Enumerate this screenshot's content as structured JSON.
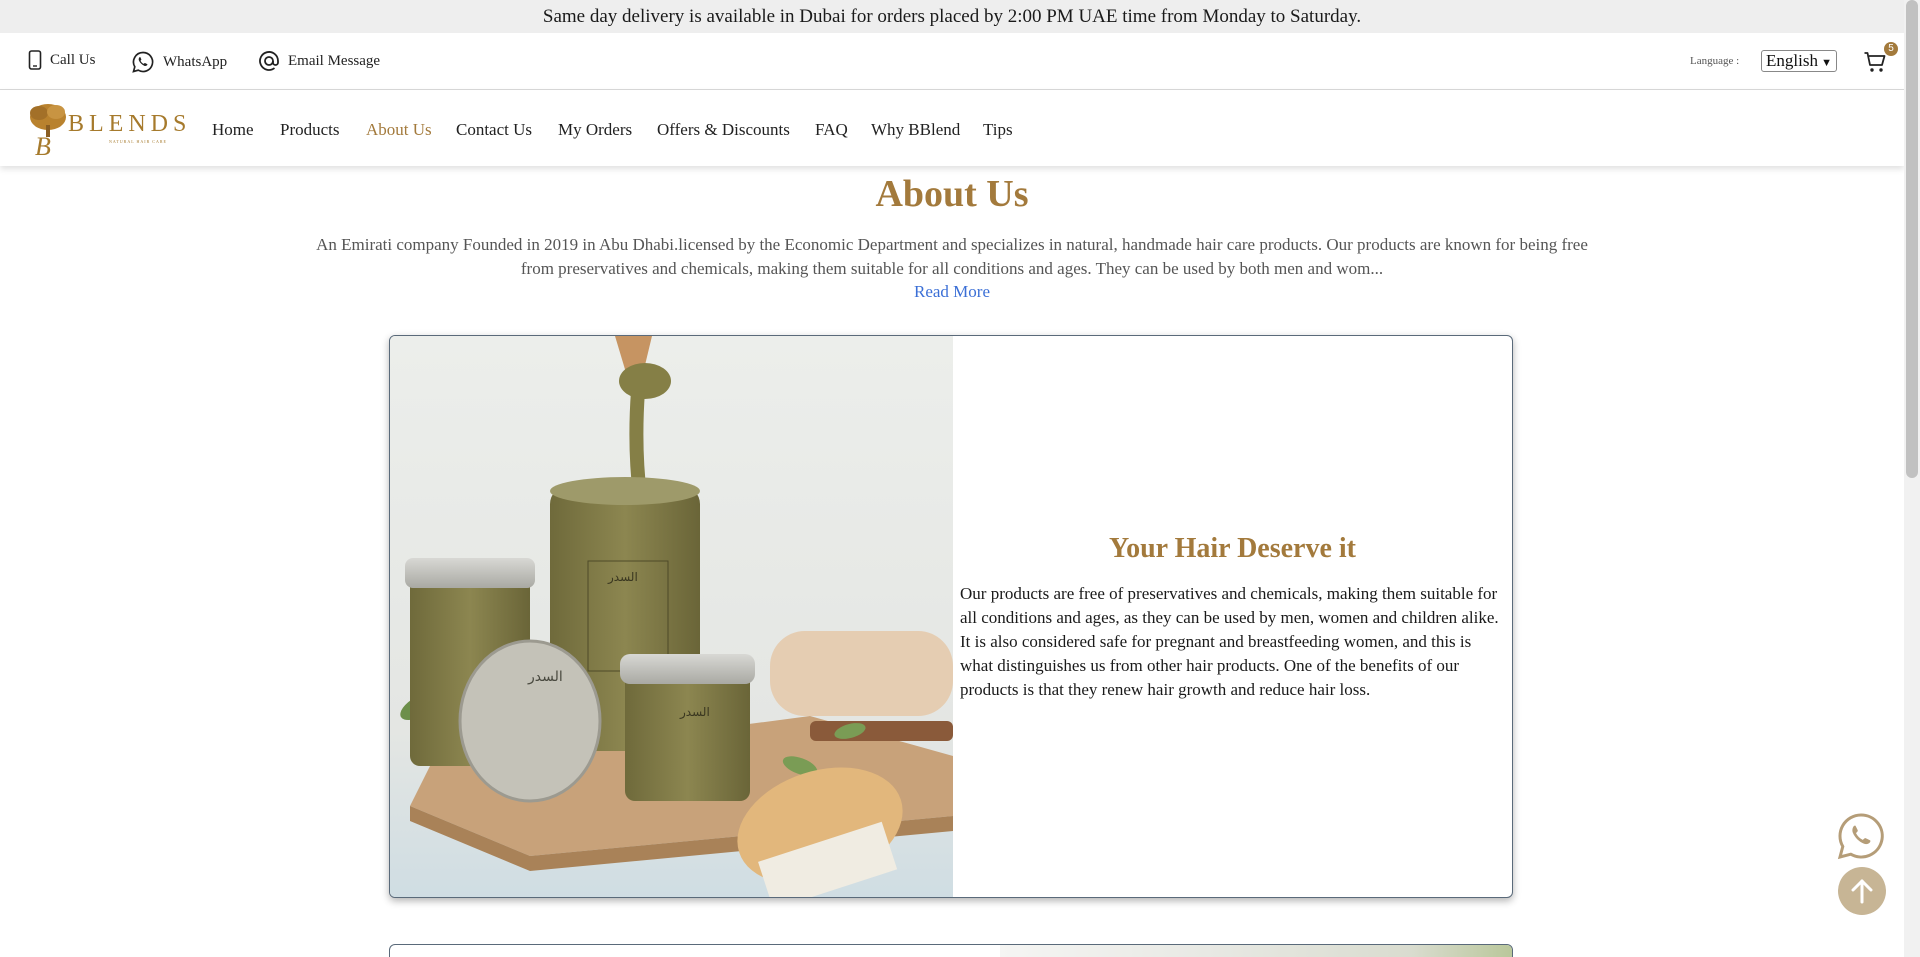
{
  "announcement": "Same day delivery is available in Dubai for orders placed by 2:00 PM UAE time from Monday to Saturday.",
  "contact": {
    "call": "Call Us",
    "whatsapp": "WhatsApp",
    "email": "Email Message"
  },
  "language": {
    "label": "Language :",
    "selected": "English"
  },
  "cart": {
    "count": "5"
  },
  "logo": {
    "name": "BLENDS",
    "tagline": "NATURAL HAIR CARE"
  },
  "nav": {
    "items": [
      "Home",
      "Products",
      "About Us",
      "Contact Us",
      "My Orders",
      "Offers & Discounts",
      "FAQ",
      "Why BBlend",
      "Tips"
    ],
    "active": "About Us"
  },
  "about": {
    "title": "About Us",
    "intro": "An Emirati company Founded in 2019 in Abu Dhabi.licensed by the Economic Department and specializes in natural, handmade hair care products. Our products are known for being free from preservatives and chemicals, making them suitable for all conditions and ages. They can be used by both men and wom...",
    "read_more": "Read More"
  },
  "feature": {
    "title": "Your Hair Deserve it",
    "text": "Our products are free of preservatives and chemicals, making them suitable for all conditions and ages, as they can be used by men, women and children alike. It is also considered safe for pregnant and breastfeeding women, and this is what distinguishes us from other hair products. One of the benefits of our products is that they renew hair growth and reduce hair loss.",
    "jar_label": "السدر"
  },
  "colors": {
    "accent": "#a37a3c",
    "link": "#3b6fd6",
    "float_button": "#c7b595"
  },
  "icons": {
    "call": "phone-icon",
    "whatsapp": "whatsapp-icon",
    "email": "at-sign-icon",
    "cart": "cart-icon",
    "scroll_top": "arrow-up-icon"
  }
}
